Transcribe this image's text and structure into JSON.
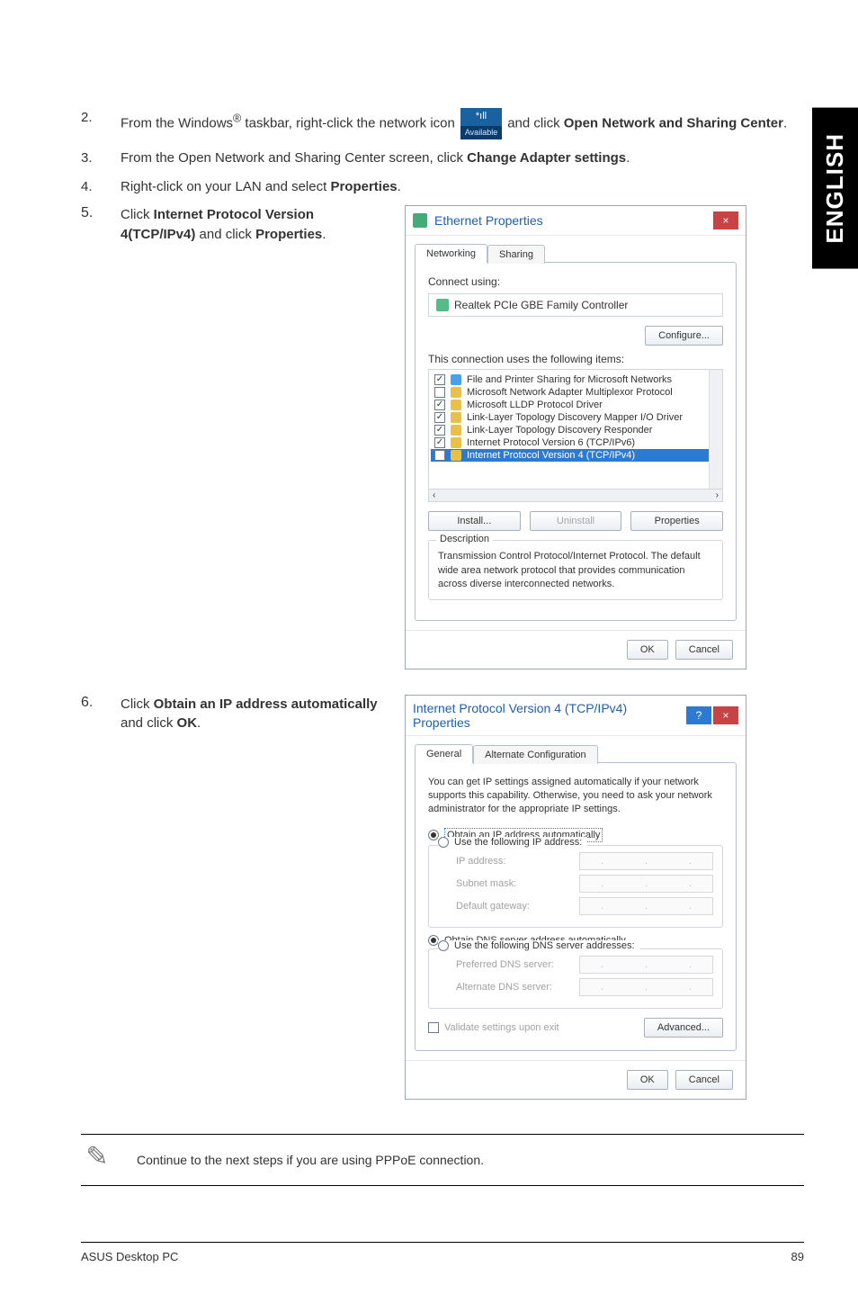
{
  "side_tab": "ENGLISH",
  "steps": {
    "s2": {
      "num": "2.",
      "pre": "From the Windows",
      "sup": "®",
      "post_a": " taskbar, right-click the network icon ",
      "post_b": " and click ",
      "bold": "Open Network and Sharing Center",
      "end": "."
    },
    "s3": {
      "num": "3.",
      "pre": "From the Open Network and Sharing Center screen, click ",
      "bold": "Change Adapter settings",
      "end": "."
    },
    "s4": {
      "num": "4.",
      "pre": "Right-click on your LAN and select ",
      "bold": "Properties",
      "end": "."
    },
    "s5": {
      "num": "5.",
      "pre": "Click ",
      "bold_a": "Internet Protocol Version 4(TCP/IPv4)",
      "mid": " and click ",
      "bold_b": "Properties",
      "end": "."
    },
    "s6": {
      "num": "6.",
      "pre": "Click ",
      "bold_a": "Obtain an IP address automatically",
      "mid": " and click ",
      "bold_b": "OK",
      "end": "."
    }
  },
  "tray_icon": {
    "top": "*ıll",
    "bottom": "Available"
  },
  "ethernet_dialog": {
    "title": "Ethernet Properties",
    "close": "×",
    "tabs": {
      "networking": "Networking",
      "sharing": "Sharing"
    },
    "connect_using": "Connect using:",
    "adapter": "Realtek PCIe GBE Family Controller",
    "configure": "Configure...",
    "items_label": "This connection uses the following items:",
    "items": [
      {
        "checked": true,
        "icon": "net",
        "label": "File and Printer Sharing for Microsoft Networks"
      },
      {
        "checked": false,
        "icon": "proto",
        "label": "Microsoft Network Adapter Multiplexor Protocol"
      },
      {
        "checked": true,
        "icon": "proto",
        "label": "Microsoft LLDP Protocol Driver"
      },
      {
        "checked": true,
        "icon": "proto",
        "label": "Link-Layer Topology Discovery Mapper I/O Driver"
      },
      {
        "checked": true,
        "icon": "proto",
        "label": "Link-Layer Topology Discovery Responder"
      },
      {
        "checked": true,
        "icon": "proto",
        "label": "Internet Protocol Version 6 (TCP/IPv6)"
      },
      {
        "checked": true,
        "icon": "proto",
        "label": "Internet Protocol Version 4 (TCP/IPv4)",
        "selected": true
      }
    ],
    "scroll_left": "‹",
    "scroll_right": "›",
    "install": "Install...",
    "uninstall": "Uninstall",
    "properties": "Properties",
    "desc_title": "Description",
    "desc_text": "Transmission Control Protocol/Internet Protocol. The default wide area network protocol that provides communication across diverse interconnected networks.",
    "ok": "OK",
    "cancel": "Cancel"
  },
  "ipv4_dialog": {
    "title": "Internet Protocol Version 4 (TCP/IPv4) Properties",
    "help": "?",
    "close": "×",
    "tabs": {
      "general": "General",
      "alt": "Alternate Configuration"
    },
    "intro": "You can get IP settings assigned automatically if your network supports this capability. Otherwise, you need to ask your network administrator for the appropriate IP settings.",
    "radio_obtain_ip": "Obtain an IP address automatically",
    "radio_use_ip": "Use the following IP address:",
    "ip_address": "IP address:",
    "subnet": "Subnet mask:",
    "gateway": "Default gateway:",
    "radio_obtain_dns": "Obtain DNS server address automatically",
    "radio_use_dns": "Use the following DNS server addresses:",
    "pref_dns": "Preferred DNS server:",
    "alt_dns": "Alternate DNS server:",
    "validate": "Validate settings upon exit",
    "advanced": "Advanced...",
    "ok": "OK",
    "cancel": "Cancel",
    "dot": "."
  },
  "note": "Continue to the next steps if you are using PPPoE connection.",
  "footer": {
    "left": "ASUS Desktop PC",
    "right": "89"
  }
}
